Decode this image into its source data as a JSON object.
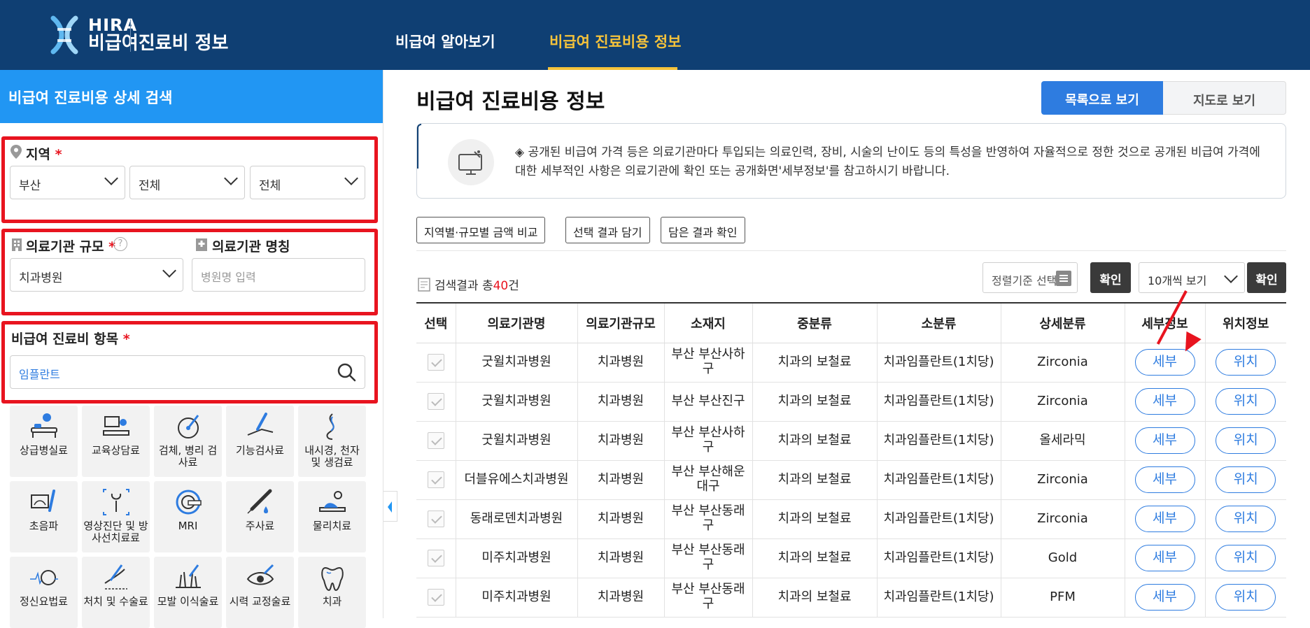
{
  "header": {
    "logo_line1": "HIRA",
    "logo_line2": "비급여진료비 정보",
    "nav": [
      {
        "label": "비급여 알아보기",
        "active": false
      },
      {
        "label": "비급여 진료비용 정보",
        "active": true
      }
    ]
  },
  "sidebar": {
    "title": "비급여 진료비용 상세 검색",
    "region": {
      "label": "지역",
      "required": "*",
      "selects": [
        "부산",
        "전체",
        "전체"
      ]
    },
    "institution": {
      "scale_label": "의료기관 규모",
      "required": "*",
      "help": "?",
      "scale_value": "치과병원",
      "name_label": "의료기관 명칭",
      "name_placeholder": "병원명 입력"
    },
    "item": {
      "label": "비급여 진료비 항목",
      "required": "*",
      "value": "임플란트"
    },
    "categories": [
      {
        "label": "상급병실료",
        "icon": "hospital-bed-icon"
      },
      {
        "label": "교육상담료",
        "icon": "counseling-icon"
      },
      {
        "label": "검체, 병리 검사료",
        "icon": "specimen-icon"
      },
      {
        "label": "기능검사료",
        "icon": "function-test-icon"
      },
      {
        "label": "내시경, 천자 및 생검료",
        "icon": "endoscope-icon"
      },
      {
        "label": "초음파",
        "icon": "ultrasound-icon"
      },
      {
        "label": "영상진단 및 방사선치료료",
        "icon": "xray-icon"
      },
      {
        "label": "MRI",
        "icon": "mri-icon"
      },
      {
        "label": "주사료",
        "icon": "injection-icon"
      },
      {
        "label": "물리치료",
        "icon": "physical-therapy-icon"
      },
      {
        "label": "정신요법료",
        "icon": "brain-icon"
      },
      {
        "label": "처치 및 수술료",
        "icon": "surgery-icon"
      },
      {
        "label": "모발 이식술료",
        "icon": "hair-icon"
      },
      {
        "label": "시력 교정술료",
        "icon": "eye-icon"
      },
      {
        "label": "치과",
        "icon": "tooth-icon"
      }
    ]
  },
  "main": {
    "title": "비급여 진료비용 정보",
    "view_list": "목록으로 보기",
    "view_map": "지도로 보기",
    "notice": "◈ 공개된 비급여 가격 등은 의료기관마다 투입되는 의료인력, 장비, 시술의 난이도 등의 특성을 반영하여 자율적으로 정한 것으로 공개된 비급여 가격에 대한 세부적인 사항은 의료기관에 확인 또는 공개화면'세부정보'를 참고하시기 바랍니다.",
    "buttons": [
      "지역별·규모별 금액 비교",
      "선택 결과 담기",
      "담은 결과 확인"
    ],
    "result_prefix": "검색결과 총",
    "result_count": "40",
    "result_suffix": "건",
    "sort_label": "정렬기준 선택",
    "confirm": "확인",
    "page_size": "10개씩 보기",
    "table": {
      "headers": [
        "선택",
        "의료기관명",
        "의료기관규모",
        "소재지",
        "중분류",
        "소분류",
        "상세분류",
        "세부정보",
        "위치정보"
      ],
      "rows": [
        {
          "name": "굿윌치과병원",
          "scale": "치과병원",
          "loc": "부산 부산사하구",
          "mid": "치과의 보철료",
          "sub": "치과임플란트(1치당)",
          "detail": "Zirconia"
        },
        {
          "name": "굿윌치과병원",
          "scale": "치과병원",
          "loc": "부산 부산진구",
          "mid": "치과의 보철료",
          "sub": "치과임플란트(1치당)",
          "detail": "Zirconia"
        },
        {
          "name": "굿윌치과병원",
          "scale": "치과병원",
          "loc": "부산 부산사하구",
          "mid": "치과의 보철료",
          "sub": "치과임플란트(1치당)",
          "detail": "올세라믹"
        },
        {
          "name": "더블유에스치과병원",
          "scale": "치과병원",
          "loc": "부산 부산해운대구",
          "mid": "치과의 보철료",
          "sub": "치과임플란트(1치당)",
          "detail": "Zirconia"
        },
        {
          "name": "동래로덴치과병원",
          "scale": "치과병원",
          "loc": "부산 부산동래구",
          "mid": "치과의 보철료",
          "sub": "치과임플란트(1치당)",
          "detail": "Zirconia"
        },
        {
          "name": "미주치과병원",
          "scale": "치과병원",
          "loc": "부산 부산동래구",
          "mid": "치과의 보철료",
          "sub": "치과임플란트(1치당)",
          "detail": "Gold"
        },
        {
          "name": "미주치과병원",
          "scale": "치과병원",
          "loc": "부산 부산동래구",
          "mid": "치과의 보철료",
          "sub": "치과임플란트(1치당)",
          "detail": "PFM"
        }
      ],
      "detail_btn": "세부",
      "location_btn": "위치"
    }
  },
  "colors": {
    "header_bg": "#0f3f73",
    "accent_yellow": "#f5c33b",
    "sidebar_blue": "#2196f3",
    "highlight_red": "#e8141f",
    "pill_blue": "#2e7ce0"
  }
}
